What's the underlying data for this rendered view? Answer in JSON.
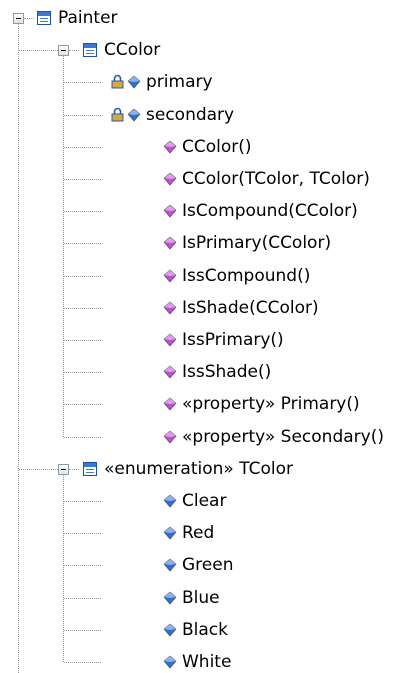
{
  "tree": {
    "root": {
      "label": "Painter",
      "icon": "class-icon",
      "expanded": true,
      "children": [
        {
          "label": "CColor",
          "icon": "class-icon",
          "expanded": true,
          "members": [
            {
              "label": "primary",
              "icon": "attribute-icon",
              "locked": true
            },
            {
              "label": "secondary",
              "icon": "attribute-icon",
              "locked": true
            },
            {
              "label": "CColor()",
              "icon": "operation-icon"
            },
            {
              "label": "CColor(TColor, TColor)",
              "icon": "operation-icon"
            },
            {
              "label": "IsCompound(CColor)",
              "icon": "operation-icon"
            },
            {
              "label": "IsPrimary(CColor)",
              "icon": "operation-icon"
            },
            {
              "label": "IssCompound()",
              "icon": "operation-icon"
            },
            {
              "label": "IsShade(CColor)",
              "icon": "operation-icon"
            },
            {
              "label": "IssPrimary()",
              "icon": "operation-icon"
            },
            {
              "label": "IssShade()",
              "icon": "operation-icon"
            },
            {
              "label": "«property» Primary()",
              "icon": "operation-icon"
            },
            {
              "label": "«property» Secondary()",
              "icon": "operation-icon"
            }
          ]
        },
        {
          "label": "«enumeration» TColor",
          "icon": "class-icon",
          "expanded": true,
          "members": [
            {
              "label": "Clear",
              "icon": "attribute-icon"
            },
            {
              "label": "Red",
              "icon": "attribute-icon"
            },
            {
              "label": "Green",
              "icon": "attribute-icon"
            },
            {
              "label": "Blue",
              "icon": "attribute-icon"
            },
            {
              "label": "Black",
              "icon": "attribute-icon"
            },
            {
              "label": "White",
              "icon": "attribute-icon"
            }
          ]
        }
      ]
    }
  },
  "colors": {
    "attribute": "#2f6fd8",
    "operation": "#c14fd6",
    "lock": "#2a56b0",
    "class_border": "#1f4fa8",
    "guide_line": "#9a9a9a"
  }
}
